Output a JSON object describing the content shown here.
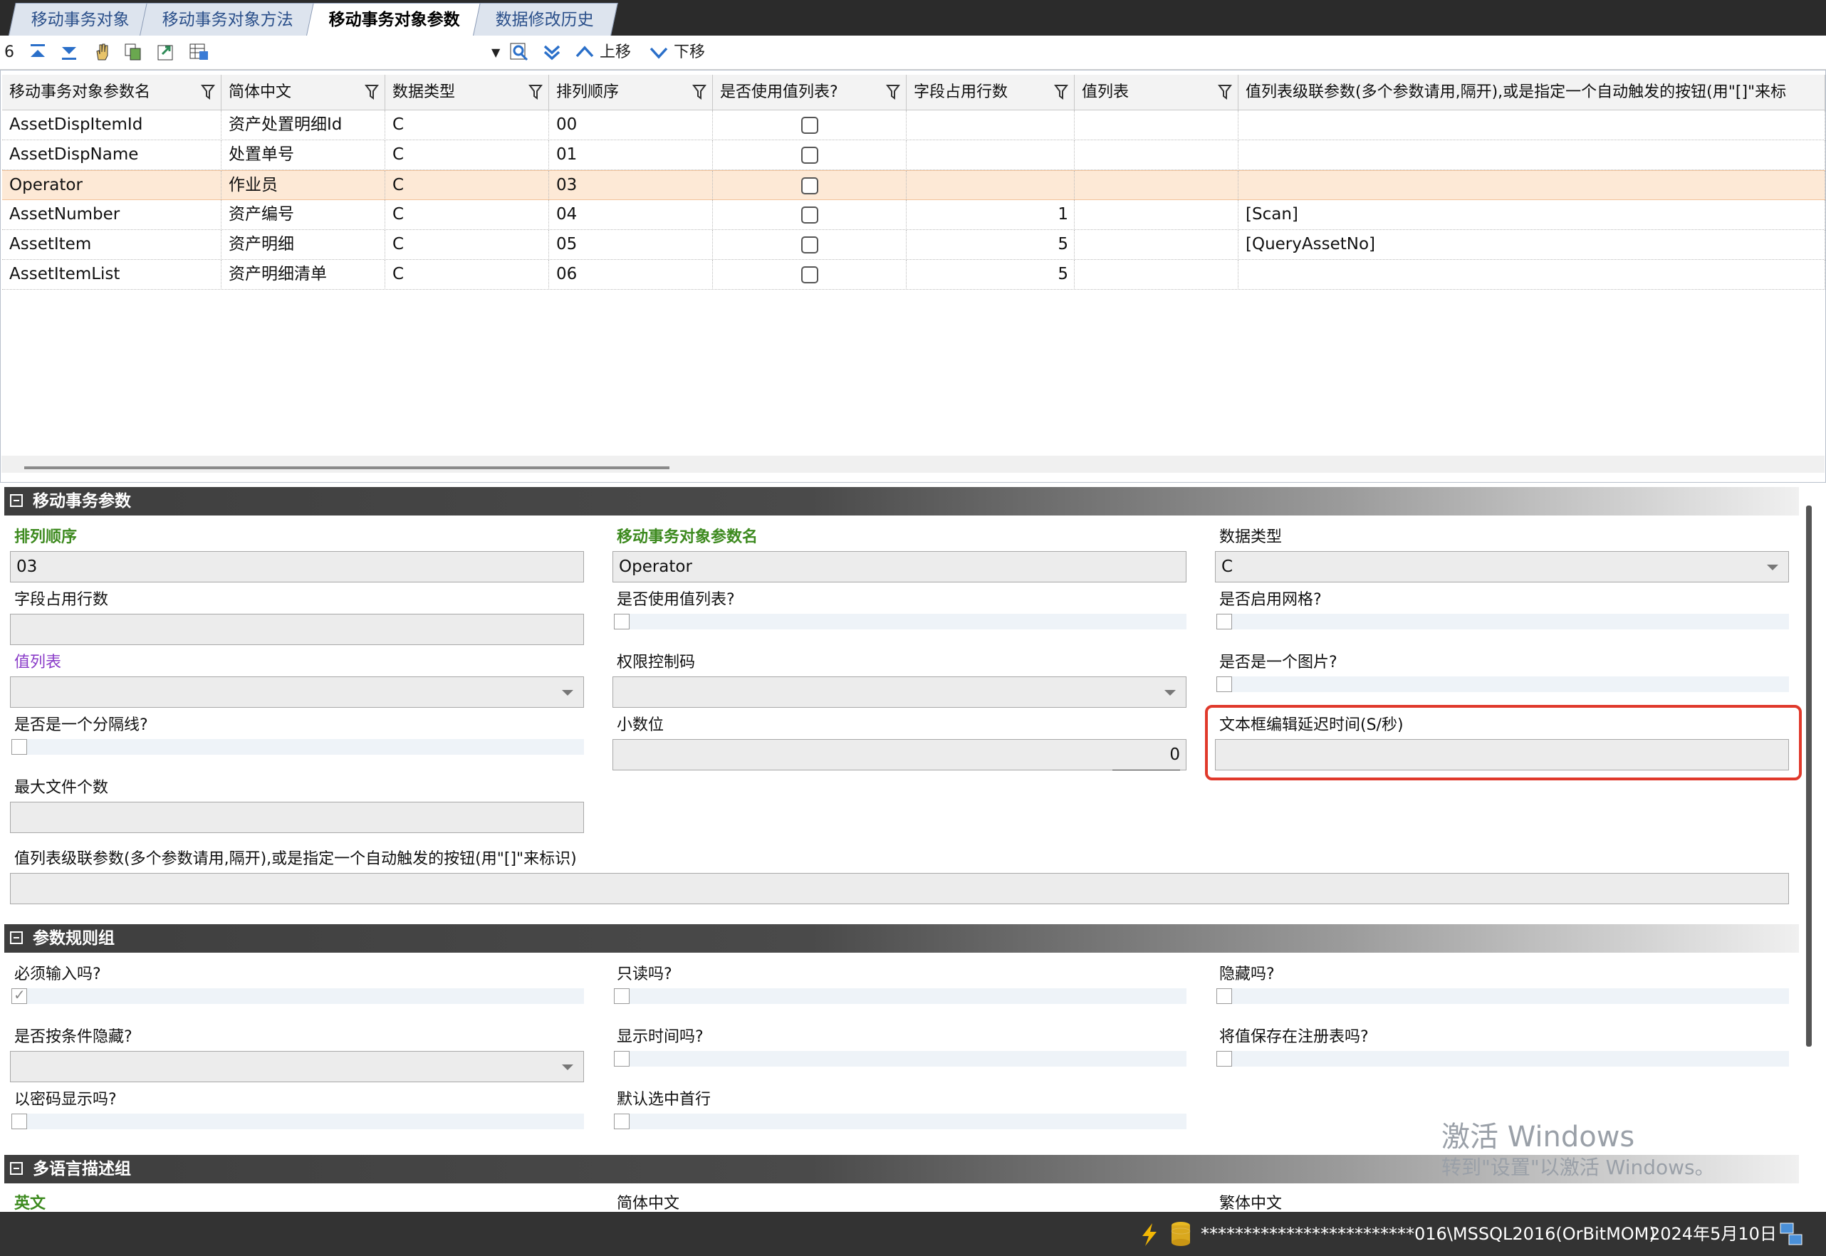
{
  "tabs": [
    {
      "label": "移动事务对象"
    },
    {
      "label": "移动事务对象方法"
    },
    {
      "label": "移动事务对象参数"
    },
    {
      "label": "数据修改历史"
    }
  ],
  "toolbar": {
    "record_count": "6",
    "move_up_label": "上移",
    "move_down_label": "下移"
  },
  "grid": {
    "columns": [
      "移动事务对象参数名",
      "简体中文",
      "数据类型",
      "排列顺序",
      "是否使用值列表?",
      "字段占用行数",
      "值列表",
      "值列表级联参数(多个参数请用,隔开),或是指定一个自动触发的按钮(用\"[]\"来标"
    ],
    "rows": [
      {
        "name": "AssetDispItemId",
        "cn": "资产处置明细Id",
        "type": "C",
        "order": "00",
        "lines": "",
        "vlist": "",
        "cascade": ""
      },
      {
        "name": "AssetDispName",
        "cn": "处置单号",
        "type": "C",
        "order": "01",
        "lines": "",
        "vlist": "",
        "cascade": ""
      },
      {
        "name": "Operator",
        "cn": "作业员",
        "type": "C",
        "order": "03",
        "lines": "",
        "vlist": "",
        "cascade": ""
      },
      {
        "name": "AssetNumber",
        "cn": "资产编号",
        "type": "C",
        "order": "04",
        "lines": "1",
        "vlist": "",
        "cascade": "[Scan]"
      },
      {
        "name": "AssetItem",
        "cn": "资产明细",
        "type": "C",
        "order": "05",
        "lines": "5",
        "vlist": "",
        "cascade": "[QueryAssetNo]"
      },
      {
        "name": "AssetItemList",
        "cn": "资产明细清单",
        "type": "C",
        "order": "06",
        "lines": "5",
        "vlist": "",
        "cascade": ""
      }
    ]
  },
  "sections": {
    "params": "移动事务参数",
    "rules": "参数规则组",
    "multilang": "多语言描述组"
  },
  "form": {
    "sort_order_label": "排列顺序",
    "sort_order_value": "03",
    "param_name_label": "移动事务对象参数名",
    "param_name_value": "Operator",
    "data_type_label": "数据类型",
    "data_type_value": "C",
    "field_lines_label": "字段占用行数",
    "use_value_list_label": "是否使用值列表?",
    "enable_grid_label": "是否启用网格?",
    "value_list_label": "值列表",
    "permission_code_label": "权限控制码",
    "is_image_label": "是否是一个图片?",
    "is_separator_label": "是否是一个分隔线?",
    "decimals_label": "小数位",
    "decimals_value": "0",
    "textbox_delay_label": "文本框编辑延迟时间(S/秒)",
    "max_files_label": "最大文件个数",
    "cascade_label": "值列表级联参数(多个参数请用,隔开),或是指定一个自动触发的按钮(用\"[]\"来标识)"
  },
  "rules": {
    "required_label": "必须输入吗?",
    "readonly_label": "只读吗?",
    "hidden_label": "隐藏吗?",
    "conditional_hide_label": "是否按条件隐藏?",
    "show_time_label": "显示时间吗?",
    "save_registry_label": "将值保存在注册表吗?",
    "password_label": "以密码显示吗?",
    "default_first_row_label": "默认选中首行"
  },
  "multilang": {
    "english_label": "英文",
    "simplified_label": "简体中文",
    "traditional_label": "繁体中文"
  },
  "watermark": {
    "line1": "激活 Windows",
    "line2": "转到\"设置\"以激活 Windows。"
  },
  "statusbar": {
    "connection": "*************************016\\MSSQL2016(OrBitMOM)",
    "date": "2024年5月10日"
  }
}
